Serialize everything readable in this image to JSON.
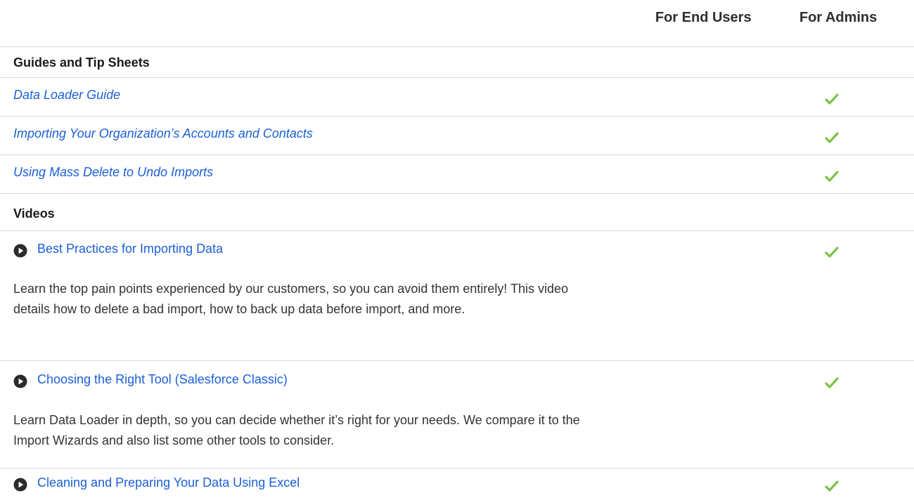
{
  "columns": {
    "end_users": "For End Users",
    "admins": "For Admins"
  },
  "guides": {
    "title": "Guides and Tip Sheets",
    "items": [
      {
        "label": "Data Loader Guide",
        "for_end_users": false,
        "for_admins": true
      },
      {
        "label": "Importing Your Organization’s Accounts and Contacts",
        "for_end_users": false,
        "for_admins": true
      },
      {
        "label": "Using Mass Delete to Undo Imports",
        "for_end_users": false,
        "for_admins": true
      }
    ]
  },
  "videos": {
    "title": "Videos",
    "items": [
      {
        "label": "Best Practices for Importing Data",
        "description": "Learn the top pain points experienced by our customers, so you can avoid them entirely! This video details how to delete a bad import, how to back up data before import, and more.",
        "for_end_users": false,
        "for_admins": true
      },
      {
        "label": "Choosing the Right Tool (Salesforce Classic)",
        "description": "Learn Data Loader in depth, so you can decide whether it’s right for your needs. We compare it to the Import Wizards and also list some other tools to consider.",
        "for_end_users": false,
        "for_admins": true
      },
      {
        "label": "Cleaning and Preparing Your Data Using Excel",
        "for_end_users": false,
        "for_admins": true
      }
    ]
  },
  "colors": {
    "link": "#1a5fd8",
    "check": "#7cc242",
    "divider": "#d7d7d7"
  }
}
